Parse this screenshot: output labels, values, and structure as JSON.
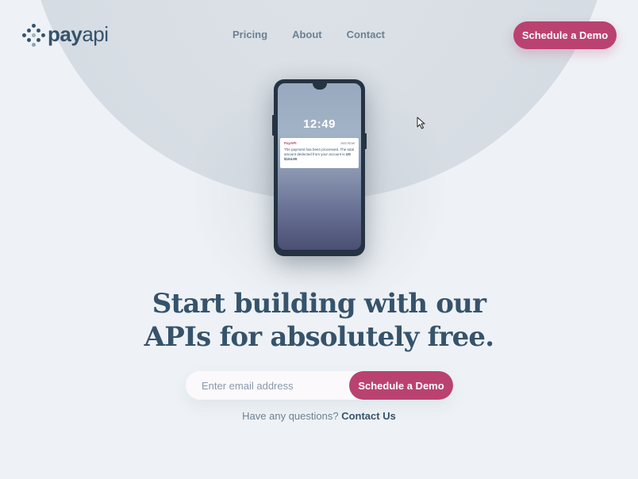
{
  "brand": {
    "name_bold": "pay",
    "name_light": "api",
    "logo_icon": "payapi-dots-logo-icon",
    "accent_color": "#ba4270",
    "primary_text_color": "#36536b"
  },
  "nav": {
    "items": [
      {
        "label": "Pricing"
      },
      {
        "label": "About"
      },
      {
        "label": "Contact"
      }
    ],
    "cta_label": "Schedule a Demo"
  },
  "phone": {
    "time": "12:49",
    "notification": {
      "app": "PayAPI",
      "when": "Just Now",
      "message_prefix": "The payment has been processed. The total amount deducted from your account is ",
      "amount": "US $104.90",
      "message_suffix": "."
    }
  },
  "hero": {
    "headline_line1": "Start building with our",
    "headline_line2": "APIs for absolutely free."
  },
  "signup": {
    "email_placeholder": "Enter email address",
    "button_label": "Schedule a Demo"
  },
  "contact": {
    "question": "Have any questions?",
    "link_label": "Contact Us"
  },
  "cursor_icon": "mouse-pointer-icon"
}
